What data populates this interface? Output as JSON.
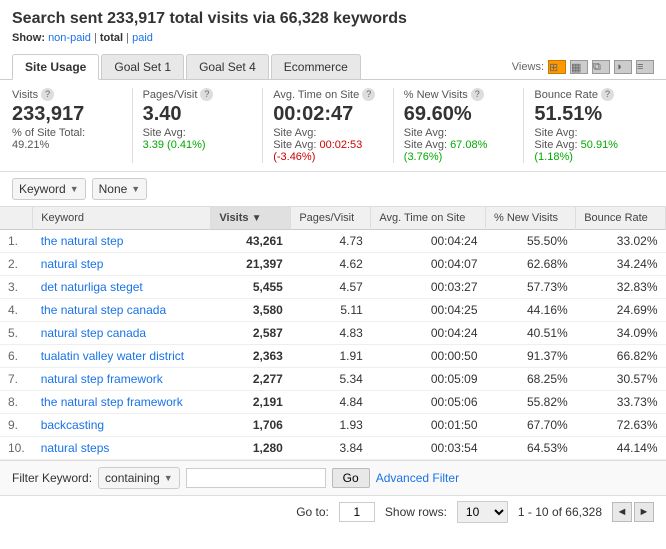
{
  "header": {
    "title": "Search sent 233,917 total visits via 66,328 keywords",
    "show_label": "Show:",
    "links": [
      {
        "text": "non-paid",
        "active": false
      },
      {
        "text": "total",
        "active": true
      },
      {
        "text": "paid",
        "active": false
      }
    ]
  },
  "tabs": {
    "items": [
      {
        "label": "Site Usage",
        "active": true
      },
      {
        "label": "Goal Set 1",
        "active": false
      },
      {
        "label": "Goal Set 4",
        "active": false
      },
      {
        "label": "Ecommerce",
        "active": false
      }
    ],
    "views_label": "Views:"
  },
  "metrics": [
    {
      "label": "Visits",
      "value": "233,917",
      "sub_line1": "% of Site Total:",
      "sub_line2": "49.21%"
    },
    {
      "label": "Pages/Visit",
      "value": "3.40",
      "sub_line1": "Site Avg:",
      "sub_line2": "3.39 (0.41%)",
      "sub_color": "green"
    },
    {
      "label": "Avg. Time on Site",
      "value": "00:02:47",
      "sub_line1": "Site Avg:",
      "sub_line2": "00:02:53 (-3.46%)",
      "sub_color": "red"
    },
    {
      "label": "% New Visits",
      "value": "69.60%",
      "sub_line1": "Site Avg:",
      "sub_line2": "67.08% (3.76%)",
      "sub_color": "green"
    },
    {
      "label": "Bounce Rate",
      "value": "51.51%",
      "sub_line1": "Site Avg:",
      "sub_line2": "50.91% (1.18%)",
      "sub_color": "green"
    }
  ],
  "table": {
    "keyword_dropdown": "Keyword",
    "none_dropdown": "None",
    "columns": [
      "",
      "Keyword",
      "Visits",
      "Pages/Visit",
      "Avg. Time on Site",
      "% New Visits",
      "Bounce Rate"
    ],
    "rows": [
      {
        "rank": "1.",
        "keyword": "the natural step",
        "visits": "43,261",
        "pages": "4.73",
        "time": "00:04:24",
        "new_visits": "55.50%",
        "bounce": "33.02%"
      },
      {
        "rank": "2.",
        "keyword": "natural step",
        "visits": "21,397",
        "pages": "4.62",
        "time": "00:04:07",
        "new_visits": "62.68%",
        "bounce": "34.24%"
      },
      {
        "rank": "3.",
        "keyword": "det naturliga steget",
        "visits": "5,455",
        "pages": "4.57",
        "time": "00:03:27",
        "new_visits": "57.73%",
        "bounce": "32.83%"
      },
      {
        "rank": "4.",
        "keyword": "the natural step canada",
        "visits": "3,580",
        "pages": "5.11",
        "time": "00:04:25",
        "new_visits": "44.16%",
        "bounce": "24.69%"
      },
      {
        "rank": "5.",
        "keyword": "natural step canada",
        "visits": "2,587",
        "pages": "4.83",
        "time": "00:04:24",
        "new_visits": "40.51%",
        "bounce": "34.09%"
      },
      {
        "rank": "6.",
        "keyword": "tualatin valley water district",
        "visits": "2,363",
        "pages": "1.91",
        "time": "00:00:50",
        "new_visits": "91.37%",
        "bounce": "66.82%"
      },
      {
        "rank": "7.",
        "keyword": "natural step framework",
        "visits": "2,277",
        "pages": "5.34",
        "time": "00:05:09",
        "new_visits": "68.25%",
        "bounce": "30.57%"
      },
      {
        "rank": "8.",
        "keyword": "the natural step framework",
        "visits": "2,191",
        "pages": "4.84",
        "time": "00:05:06",
        "new_visits": "55.82%",
        "bounce": "33.73%"
      },
      {
        "rank": "9.",
        "keyword": "backcasting",
        "visits": "1,706",
        "pages": "1.93",
        "time": "00:01:50",
        "new_visits": "67.70%",
        "bounce": "72.63%"
      },
      {
        "rank": "10.",
        "keyword": "natural steps",
        "visits": "1,280",
        "pages": "3.84",
        "time": "00:03:54",
        "new_visits": "64.53%",
        "bounce": "44.14%"
      }
    ]
  },
  "filter": {
    "label": "Filter Keyword:",
    "dropdown": "containing",
    "input_value": "",
    "go_label": "Go",
    "advanced_label": "Advanced Filter"
  },
  "pagination": {
    "goto_label": "Go to:",
    "goto_value": "1",
    "show_rows_label": "Show rows:",
    "rows_value": "10",
    "range": "1 - 10 of 66,328",
    "prev": "◄",
    "next": "►"
  }
}
